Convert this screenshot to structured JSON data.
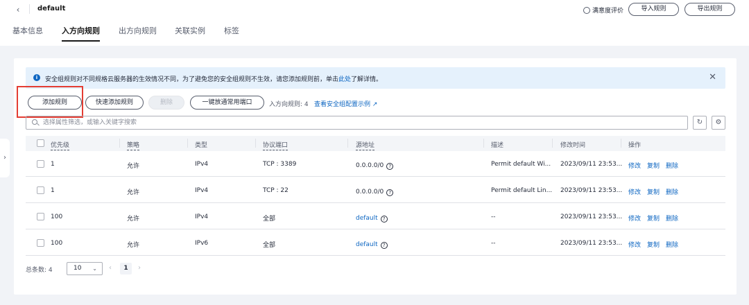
{
  "header": {
    "back_icon": "chevron-left-icon",
    "title": "default",
    "satisfaction": "满意度评价",
    "import_label": "导入规则",
    "export_label": "导出规则"
  },
  "tabs": [
    {
      "label": "基本信息",
      "active": false
    },
    {
      "label": "入方向规则",
      "active": true
    },
    {
      "label": "出方向规则",
      "active": false
    },
    {
      "label": "关联实例",
      "active": false
    },
    {
      "label": "标签",
      "active": false
    }
  ],
  "alert": {
    "text_before": "安全组规则对不同规格云服务器的生效情况不同，为了避免您的安全组规则不生效，请您添加规则前，单击",
    "link": "此处",
    "text_after": "了解详情。"
  },
  "toolbar": {
    "add": "添加规则",
    "quick_add": "快速添加规则",
    "delete": "删除",
    "open_common": "一键放通常用端口",
    "rule_count": "入方向规则: 4",
    "example_link": "查看安全组配置示例"
  },
  "search": {
    "placeholder": "选择属性筛选，或输入关键字搜索"
  },
  "table": {
    "headers": [
      "优先级",
      "策略",
      "类型",
      "协议端口",
      "源地址",
      "描述",
      "修改时间",
      "操作"
    ],
    "rows": [
      {
        "priority": "1",
        "policy": "允许",
        "type": "IPv4",
        "port": "TCP : 3389",
        "source": "0.0.0.0/0",
        "source_link": false,
        "desc": "Permit default Wi...",
        "time": "2023/09/11 23:53..."
      },
      {
        "priority": "1",
        "policy": "允许",
        "type": "IPv4",
        "port": "TCP : 22",
        "source": "0.0.0.0/0",
        "source_link": false,
        "desc": "Permit default Lin...",
        "time": "2023/09/11 23:53..."
      },
      {
        "priority": "100",
        "policy": "允许",
        "type": "IPv4",
        "port": "全部",
        "source": "default",
        "source_link": true,
        "desc": "--",
        "time": "2023/09/11 23:53..."
      },
      {
        "priority": "100",
        "policy": "允许",
        "type": "IPv6",
        "port": "全部",
        "source": "default",
        "source_link": true,
        "desc": "--",
        "time": "2023/09/11 23:53..."
      }
    ],
    "ops": {
      "modify": "修改",
      "copy": "复制",
      "delete": "删除"
    }
  },
  "pager": {
    "total": "总条数: 4",
    "page_size": "10",
    "current_page": "1"
  },
  "colors": {
    "accent": "#0d66c2",
    "highlight": "#e43d33",
    "alert_bg": "#e5f1fc"
  }
}
